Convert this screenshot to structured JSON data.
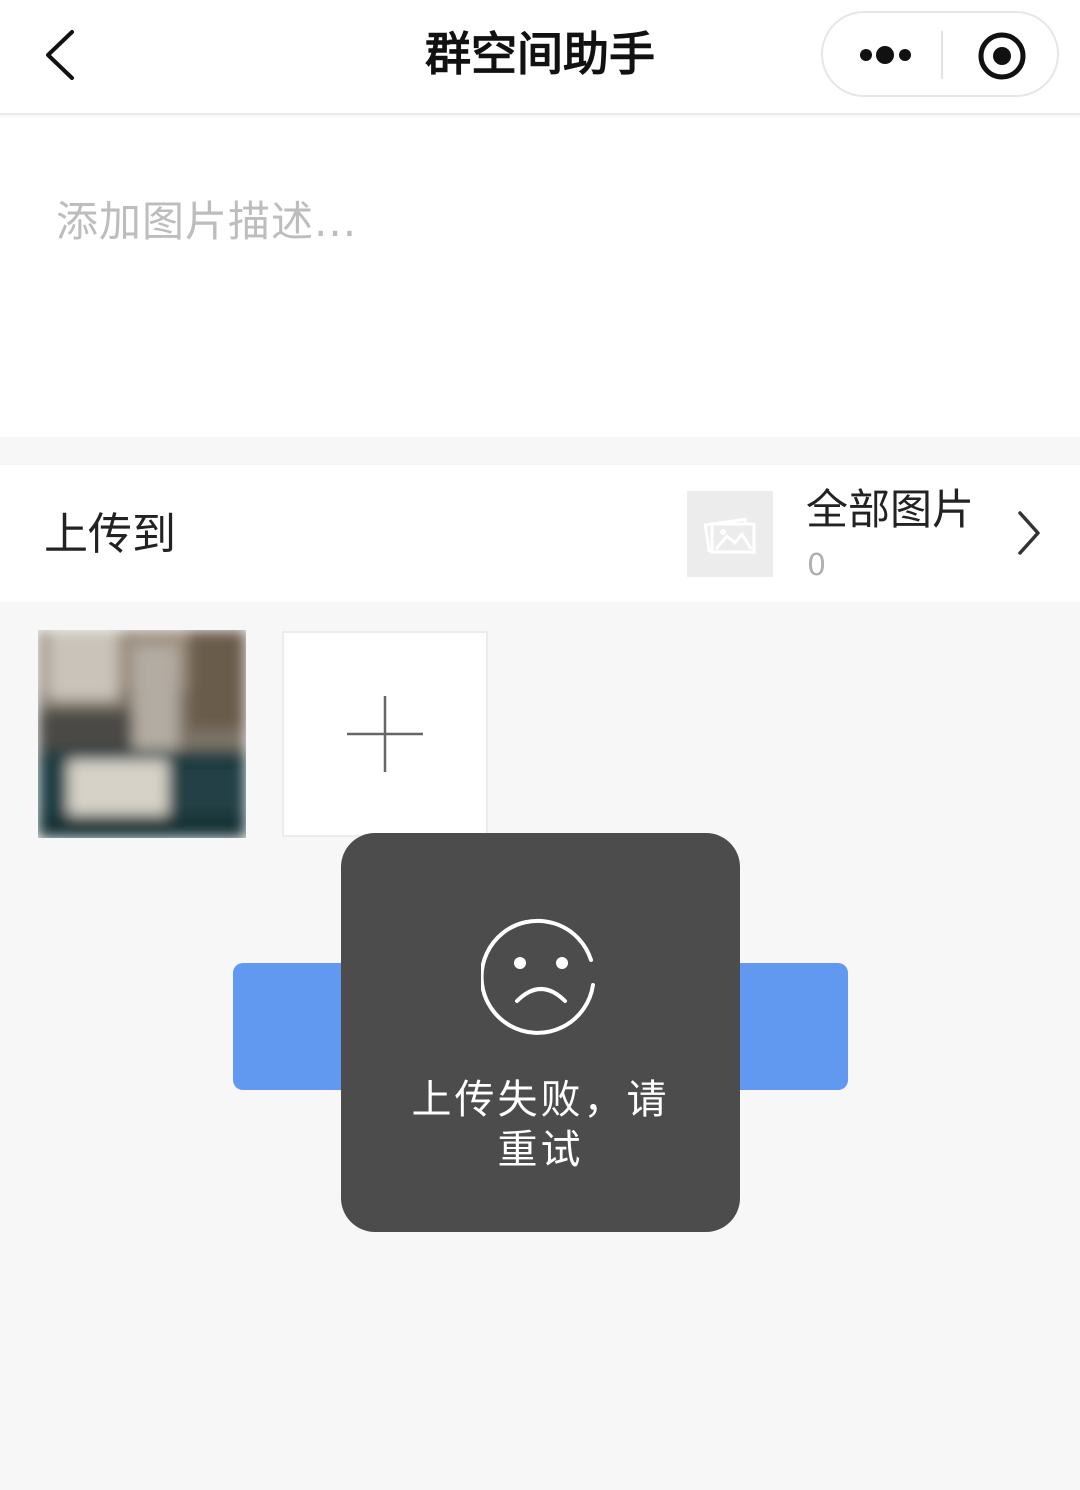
{
  "navbar": {
    "title": "群空间助手",
    "back_icon": "chevron-left-icon",
    "more_icon": "more-dots-icon",
    "close_icon": "target-close-icon"
  },
  "description": {
    "placeholder": "添加图片描述..."
  },
  "upload_target": {
    "label": "上传到",
    "album_name": "全部图片",
    "album_count": "0",
    "album_icon": "photo-album-icon",
    "arrow_icon": "chevron-right-icon"
  },
  "photos": {
    "add_icon": "plus-icon"
  },
  "submit": {
    "color": "#6198f0"
  },
  "toast": {
    "icon": "sad-face-icon",
    "message": "上传失败，请重试"
  }
}
